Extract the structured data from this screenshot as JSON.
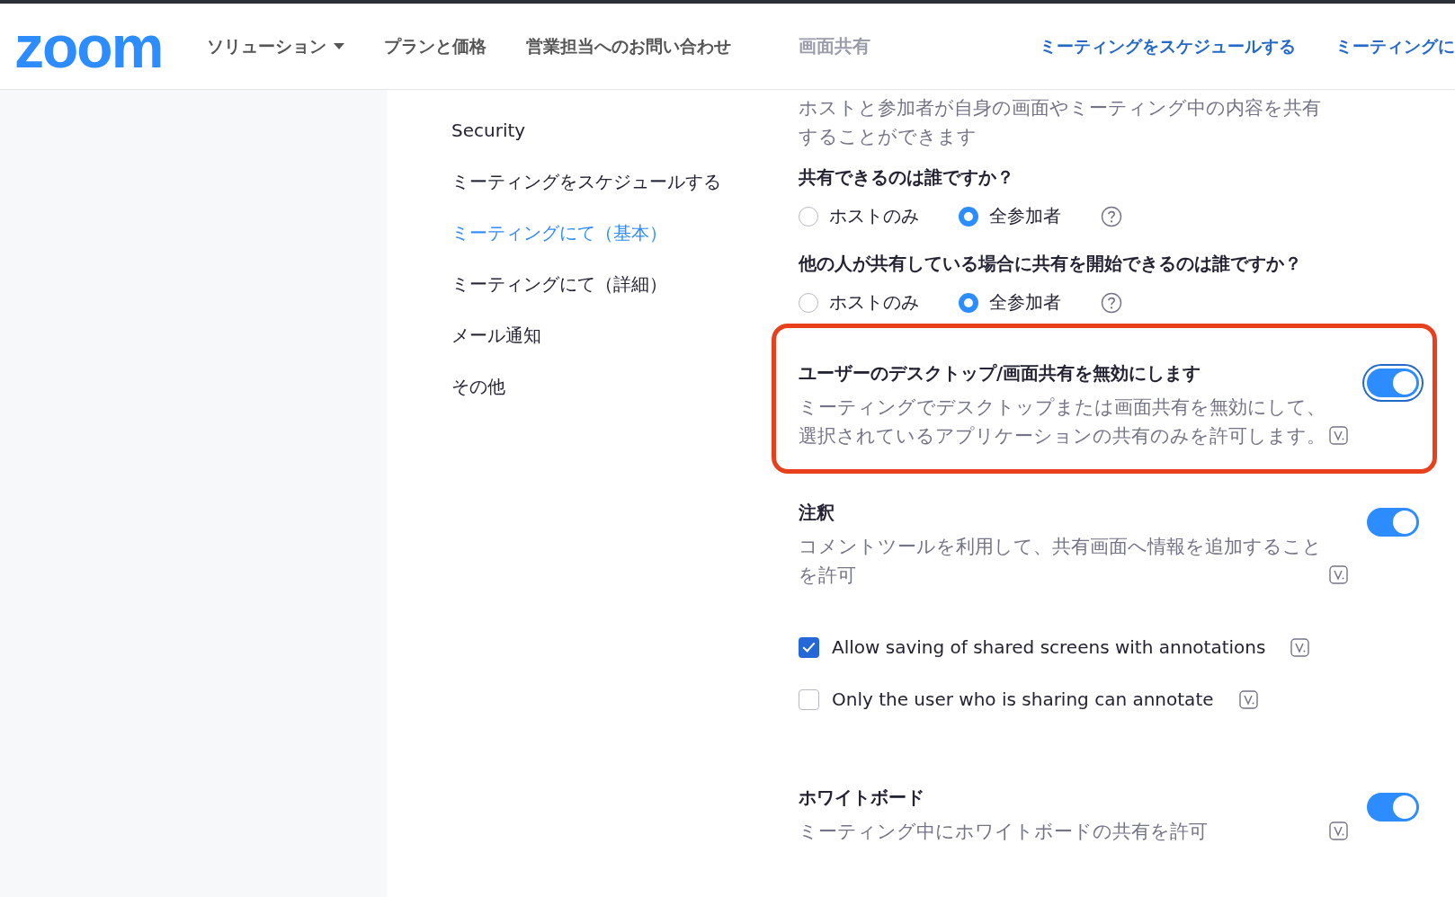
{
  "logo": "zoom",
  "nav": [
    {
      "label": "ソリューション",
      "dropdown": true
    },
    {
      "label": "プランと価格",
      "dropdown": false
    },
    {
      "label": "営業担当へのお問い合わせ",
      "dropdown": false
    }
  ],
  "header_links": [
    "ミーティングをスケジュールする",
    "ミーティングに"
  ],
  "screen_sharing": {
    "title": "画面共有",
    "description": "ホストと参加者が自身の画面やミーティング中の内容を共有することができます"
  },
  "menu": [
    {
      "label": "Security",
      "selected": false
    },
    {
      "label": "ミーティングをスケジュールする",
      "selected": false
    },
    {
      "label": "ミーティングにて（基本）",
      "selected": true
    },
    {
      "label": "ミーティングにて（詳細）",
      "selected": false
    },
    {
      "label": "メール通知",
      "selected": false
    },
    {
      "label": "その他",
      "selected": false
    }
  ],
  "settings": [
    {
      "kind": "radio",
      "question": "共有できるのは誰ですか？",
      "options": [
        {
          "label": "ホストのみ",
          "selected": false
        },
        {
          "label": "全参加者",
          "selected": true
        }
      ]
    },
    {
      "kind": "radio",
      "question": "他の人が共有している場合に共有を開始できるのは誰ですか？",
      "options": [
        {
          "label": "ホストのみ",
          "selected": false
        },
        {
          "label": "全参加者",
          "selected": true
        }
      ]
    },
    {
      "kind": "toggle",
      "title": "ユーザーのデスクトップ/画面共有を無効にします",
      "description": "ミーティングでデスクトップまたは画面共有を無効にして、選択されているアプリケーションの共有のみを許可します。",
      "on": true,
      "highlighted": true
    },
    {
      "kind": "toggle",
      "title": "注釈",
      "description": "コメントツールを利用して、共有画面へ情報を追加することを許可",
      "on": true,
      "highlighted": false
    },
    {
      "kind": "checkbox",
      "label": "Allow saving of shared screens with annotations",
      "checked": true
    },
    {
      "kind": "checkbox",
      "label": "Only the user who is sharing can annotate",
      "checked": false
    },
    {
      "kind": "toggle",
      "title": "ホワイトボード",
      "description": "ミーティング中にホワイトボードの共有を許可",
      "on": true,
      "highlighted": false
    }
  ]
}
